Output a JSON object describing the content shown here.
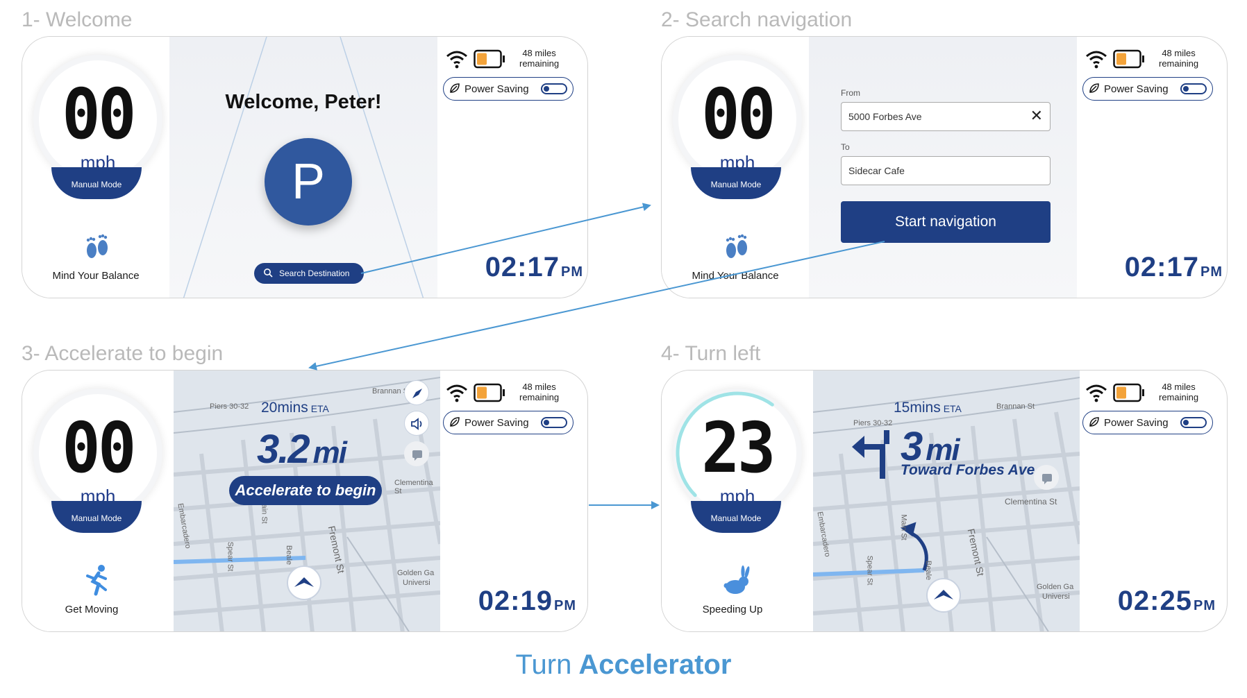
{
  "steps": [
    {
      "title": "1- Welcome"
    },
    {
      "title": "2- Search navigation"
    },
    {
      "title": "3- Accelerate to begin"
    },
    {
      "title": "4- Turn left"
    }
  ],
  "shared": {
    "speed_unit": "mph",
    "mode_label": "Manual Mode",
    "miles_line1": "48 miles",
    "miles_line2": "remaining",
    "power_saving_label": "Power Saving",
    "am_pm": "PM"
  },
  "panel1": {
    "speed": "00",
    "status_label": "Mind Your Balance",
    "welcome_text": "Welcome, Peter!",
    "avatar_letter": "P",
    "search_button_label": "Search Destination",
    "time": "02:17"
  },
  "panel2": {
    "speed": "00",
    "status_label": "Mind Your Balance",
    "from_label": "From",
    "from_value": "5000 Forbes Ave",
    "to_label": "To",
    "to_value": "Sidecar Cafe",
    "start_button_label": "Start navigation",
    "time": "02:17"
  },
  "panel3": {
    "speed": "00",
    "status_label": "Get Moving",
    "eta_value": "20mins",
    "eta_label": "ETA",
    "distance_value": "3.2",
    "distance_unit": "mi",
    "prompt": "Accelerate to begin",
    "time": "02:19",
    "map_labels": [
      "Main St",
      "Spear St",
      "Beale",
      "Fremont St",
      "Clementina St",
      "Golden Ga",
      "Universi",
      "Piers 30-32",
      "Brannan St",
      "Embarcadero"
    ]
  },
  "panel4": {
    "speed": "23",
    "speed_fraction": 0.55,
    "status_label": "Speeding Up",
    "eta_value": "15mins",
    "eta_label": "ETA",
    "distance_value": "3",
    "distance_unit": "mi",
    "toward": "Toward Forbes Ave.",
    "time": "02:25",
    "map_labels": [
      "Main St",
      "Spear St",
      "Beale",
      "Fremont St",
      "Clementina St",
      "Golden Ga",
      "Universi",
      "Piers 30-32",
      "Brannan St",
      "Embarcadero"
    ]
  },
  "caption": {
    "part1": "Turn",
    "part2": "Accelerator"
  },
  "colors": {
    "brand": "#1f3f84",
    "accent": "#4a97d2",
    "battery": "#f3a33a"
  }
}
